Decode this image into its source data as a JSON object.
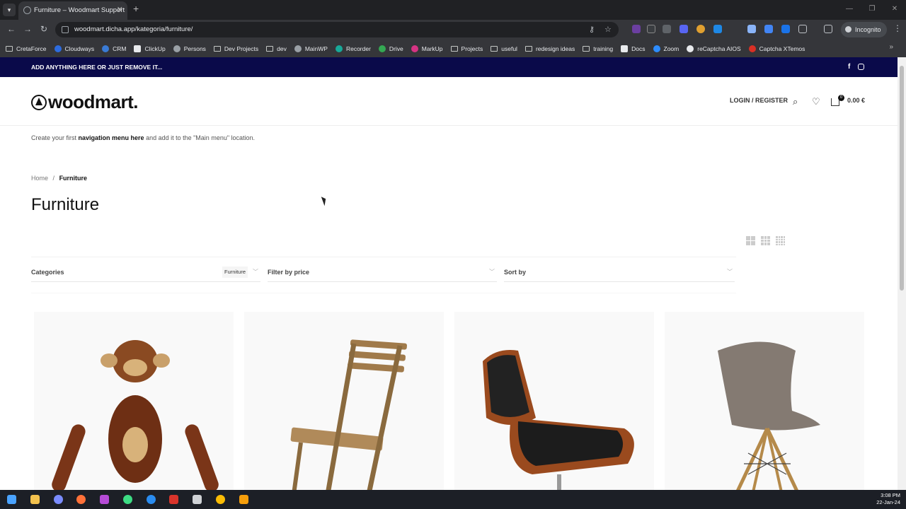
{
  "browser": {
    "tab_title": "Furniture – Woodmart Support",
    "url": "woodmart.dicha.app/kategoria/furniture/",
    "incognito_label": "Incognito",
    "bookmarks": [
      "CretaForce",
      "Cloudways",
      "CRM",
      "ClickUp",
      "Persons",
      "Dev Projects",
      "dev",
      "MainWP",
      "Recorder",
      "Drive",
      "MarkUp",
      "Projects",
      "useful",
      "redesign ideas",
      "training",
      "Docs",
      "Zoom",
      "reCaptcha AIOS",
      "Captcha XTemos"
    ]
  },
  "site": {
    "topbar_text": "ADD ANYTHING HERE OR JUST REMOVE IT...",
    "logo_text": "woodmart.",
    "login_label": "LOGIN / REGISTER",
    "cart_count": "0",
    "cart_total": "0.00 €",
    "nav_note_prefix": "Create your first ",
    "nav_note_link": "navigation menu here",
    "nav_note_suffix": " and add it to the \"Main menu\" location.",
    "breadcrumb_home": "Home",
    "breadcrumb_sep": "/",
    "breadcrumb_current": "Furniture",
    "page_title": "Furniture",
    "filters": {
      "categories_label": "Categories",
      "categories_value": "Furniture",
      "price_label": "Filter by price",
      "sort_label": "Sort by"
    },
    "products": [
      {
        "name": "wooden-monkey"
      },
      {
        "name": "folding-chair"
      },
      {
        "name": "lounge-chair"
      },
      {
        "name": "plastic-chair"
      }
    ]
  },
  "taskbar": {
    "time": "3:08 PM",
    "date": "22-Jan-24"
  },
  "colors": {
    "topbar_bg": "#0a0a4a",
    "chrome_bg": "#35363a"
  }
}
